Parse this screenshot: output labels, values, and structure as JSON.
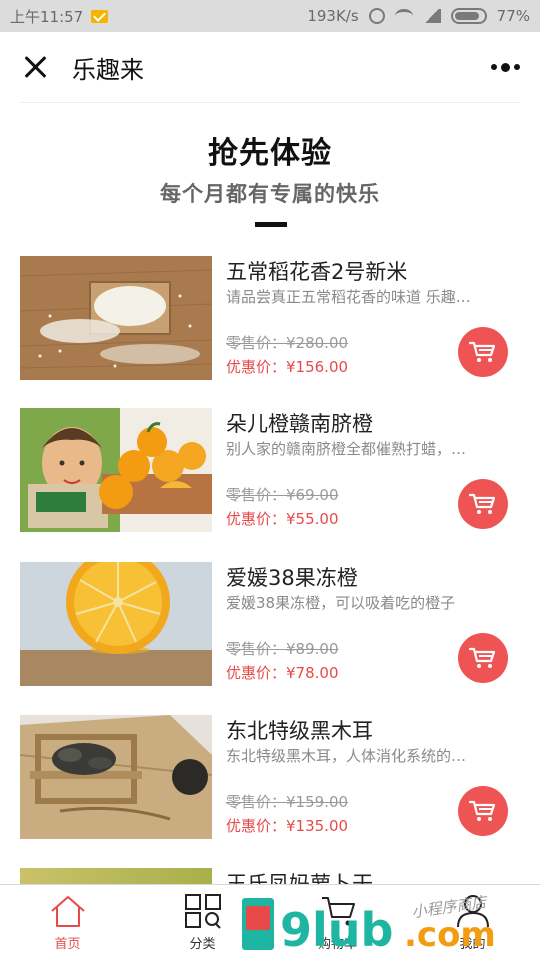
{
  "status_bar": {
    "time": "上午11:57",
    "network_speed": "193K/s",
    "battery": "77%"
  },
  "header": {
    "title": "乐趣来"
  },
  "hero": {
    "title": "抢先体验",
    "subtitle": "每个月都有专属的快乐"
  },
  "products": [
    {
      "name": "五常稻花香2号新米",
      "desc": "请品尝真正五常稻花香的味道 乐趣…",
      "retail": "零售价：¥280.00",
      "sale": "优惠价：¥156.00"
    },
    {
      "name": "朵儿橙赣南脐橙",
      "desc": "别人家的赣南脐橙全都催熟打蜡，…",
      "retail": "零售价：¥69.00",
      "sale": "优惠价：¥55.00"
    },
    {
      "name": "爱媛38果冻橙",
      "desc": "爱媛38果冻橙，可以吸着吃的橙子",
      "retail": "零售价：¥89.00",
      "sale": "优惠价：¥78.00"
    },
    {
      "name": "东北特级黑木耳",
      "desc": "东北特级黑木耳，人体消化系统的…",
      "retail": "零售价：¥159.00",
      "sale": "优惠价：¥135.00"
    },
    {
      "name": "王氏凤妈萝卜干"
    }
  ],
  "tab_bar": {
    "items": [
      {
        "label": "首页",
        "icon": "home-icon"
      },
      {
        "label": "分类",
        "icon": "category-icon"
      },
      {
        "label": "购物车",
        "icon": "cart-icon"
      },
      {
        "label": "我的",
        "icon": "user-icon"
      }
    ]
  },
  "watermark": {
    "text": "9lub.com",
    "script": "小程序商店"
  },
  "colors": {
    "accent": "#e84a4a",
    "cart_button": "#ef5454",
    "status_bar": "#dcdcdc"
  }
}
